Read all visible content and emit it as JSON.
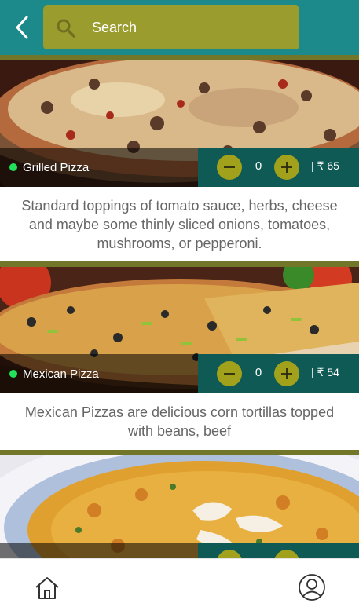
{
  "header": {
    "back_icon": "chevron-left-icon",
    "search": {
      "placeholder": "Search",
      "icon": "search-icon"
    },
    "colors": {
      "bar": "#1c8a8a",
      "search_box": "#9b9c2e"
    }
  },
  "items": [
    {
      "name": "Grilled Pizza",
      "quantity": "0",
      "price": "| ₹ 65",
      "description": "Standard toppings of tomato sauce, herbs, cheese and maybe some thinly sliced onions, tomatoes, mushrooms, or pepperoni."
    },
    {
      "name": "Mexican Pizza",
      "quantity": "0",
      "price": "| ₹ 54",
      "description": "Mexican Pizzas are delicious corn tortillas topped with beans, beef"
    },
    {
      "name": "",
      "quantity": "",
      "price": "",
      "description": ""
    }
  ],
  "bottom_nav": {
    "home_icon": "home-icon",
    "profile_icon": "user-profile-icon"
  },
  "colors": {
    "accent": "#a2a11b",
    "qty_bar": "#0f5a55",
    "divider": "#717628",
    "veg_dot": "#22e05a"
  }
}
